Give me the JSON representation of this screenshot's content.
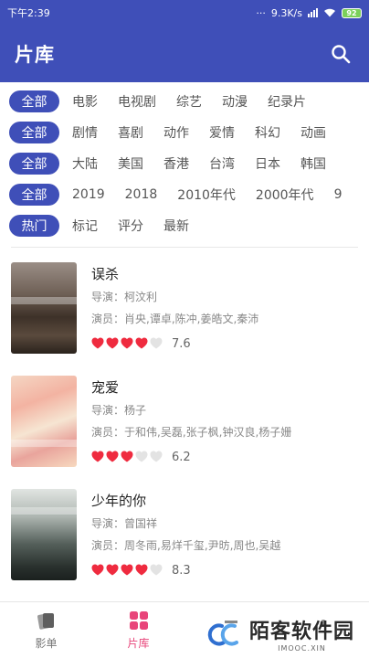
{
  "status": {
    "time": "下午2:39",
    "speed": "9.3K/s",
    "battery": "92"
  },
  "appbar": {
    "title": "片库"
  },
  "filters": [
    {
      "chip": "全部",
      "options": [
        "电影",
        "电视剧",
        "综艺",
        "动漫",
        "纪录片"
      ]
    },
    {
      "chip": "全部",
      "options": [
        "剧情",
        "喜剧",
        "动作",
        "爱情",
        "科幻",
        "动画"
      ]
    },
    {
      "chip": "全部",
      "options": [
        "大陆",
        "美国",
        "香港",
        "台湾",
        "日本",
        "韩国"
      ]
    },
    {
      "chip": "全部",
      "options": [
        "2019",
        "2018",
        "2010年代",
        "2000年代",
        "9"
      ]
    },
    {
      "chip": "热门",
      "options": [
        "标记",
        "评分",
        "最新"
      ]
    }
  ],
  "movies": [
    {
      "title": "误杀",
      "director": "导演：柯汶利",
      "cast": "演员：肖央,谭卓,陈冲,姜皓文,秦沛",
      "hearts": 4,
      "score": "7.6"
    },
    {
      "title": "宠爱",
      "director": "导演：杨子",
      "cast": "演员：于和伟,吴磊,张子枫,钟汉良,杨子姗",
      "hearts": 3,
      "score": "6.2"
    },
    {
      "title": "少年的你",
      "director": "导演：曾国祥",
      "cast": "演员：周冬雨,易烊千玺,尹昉,周也,吴越",
      "hearts": 4,
      "score": "8.3"
    }
  ],
  "nav": [
    {
      "label": "影单",
      "icon": "film-cards-icon",
      "active": false
    },
    {
      "label": "片库",
      "icon": "grid-icon",
      "active": true
    },
    {
      "label": "",
      "icon": "tab3-icon",
      "active": false
    },
    {
      "label": "",
      "icon": "tab4-icon",
      "active": false
    }
  ],
  "watermark": {
    "title": "陌客软件园",
    "subtitle": "IMOOC.XIN"
  },
  "colors": {
    "primary": "#3f4fb8",
    "heart_on": "#ef2b3f",
    "heart_off": "#e3e3e3",
    "nav_active": "#e8457a"
  }
}
